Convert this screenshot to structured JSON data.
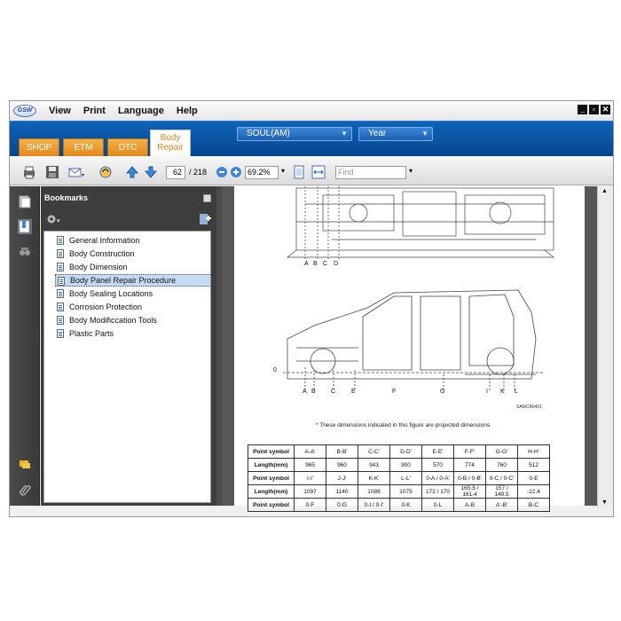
{
  "app": {
    "logo": "GSW"
  },
  "menu": [
    "View",
    "Print",
    "Language",
    "Help"
  ],
  "window_controls": [
    "minimize-icon",
    "restore-icon",
    "close-icon"
  ],
  "tabs": [
    {
      "label": "SHOP",
      "active": false
    },
    {
      "label": "ETM",
      "active": false
    },
    {
      "label": "DTC",
      "active": false
    },
    {
      "label": "Body Repair",
      "label_line1": "Body",
      "label_line2": "Repair",
      "active": true
    }
  ],
  "model_select": {
    "value": "SOUL(AM)"
  },
  "year_select": {
    "value": "Year"
  },
  "toolbar": {
    "page_current": "62",
    "page_total": "/ 218",
    "zoom": "69.2%",
    "find_placeholder": "Find"
  },
  "bookmarks": {
    "title": "Bookmarks",
    "items": [
      {
        "label": "General  Information",
        "selected": false
      },
      {
        "label": "Body Construction",
        "selected": false
      },
      {
        "label": "Body Dimension",
        "selected": false
      },
      {
        "label": "Body Panel Repair Procedure",
        "selected": true
      },
      {
        "label": "Body Sealing Locations",
        "selected": false
      },
      {
        "label": "Corrosion Protection",
        "selected": false
      },
      {
        "label": "Body Modificcation Tools",
        "selected": false
      },
      {
        "label": "Plastic Parts",
        "selected": false
      }
    ]
  },
  "document": {
    "top_labels": [
      "A",
      "B",
      "C",
      "D"
    ],
    "side_labels": [
      "A",
      "B",
      "C",
      "E",
      "F",
      "G",
      "I",
      "K",
      "L"
    ],
    "zero_label": "0",
    "figure_ref": "SAMCB0401",
    "caption": "*  These dimensions indicated in this figure are projected dimensions.",
    "table": [
      [
        "Point symbol",
        "A-A'",
        "B-B'",
        "C-C'",
        "D-D'",
        "E-E'",
        "F-F'",
        "G-G'",
        "H-H'"
      ],
      [
        "Length(mm)",
        "965",
        "960",
        "943",
        "900",
        "570",
        "774",
        "760",
        "512"
      ],
      [
        "Point symbol",
        "I-I'",
        "J-J'",
        "K-K'",
        "L-L'",
        "0-A / 0-A'",
        "0-B / 0-B'",
        "0-C / 0-C'",
        "0-E"
      ],
      [
        "Length(mm)",
        "1097",
        "1140",
        "1088",
        "1075",
        "172 / 170",
        "165.5 / 161.4",
        "157 / 149.5",
        "-22.4"
      ],
      [
        "Point symbol",
        "0-F",
        "0-G",
        "0-I / 0-I'",
        "0-K",
        "0-L",
        "A-B",
        "A'-B'",
        "B-C"
      ]
    ]
  }
}
